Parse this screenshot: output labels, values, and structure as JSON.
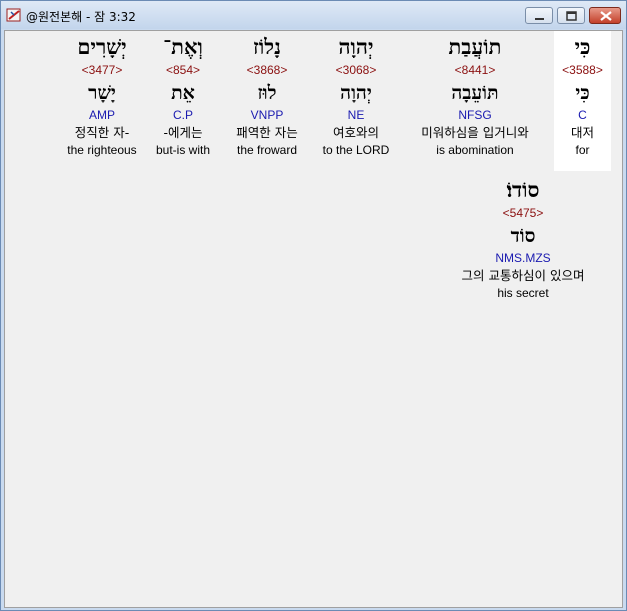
{
  "window": {
    "title": "@원전본해 - 잠 3:32",
    "app_icon": "app-icon",
    "controls": [
      "minimize-icon",
      "maximize-icon",
      "close-icon"
    ]
  },
  "words": [
    {
      "hebrew": "כִּי",
      "strong": "<3588>",
      "lemma": "כִּי",
      "morph": "C",
      "korean": "대저",
      "english": "for"
    },
    {
      "hebrew": "תוֹעֲבַת",
      "strong": "<8441>",
      "lemma": "תּוֹעֵבָה",
      "morph": "NFSG",
      "korean": "미워하심을 입거니와",
      "english": "is abomination"
    },
    {
      "hebrew": "יְהוָה",
      "strong": "<3068>",
      "lemma": "יְהוָה",
      "morph": "NE",
      "korean": "여호와의",
      "english": "to the LORD"
    },
    {
      "hebrew": "נָלוֹז",
      "strong": "<3868>",
      "lemma": "לוּז",
      "morph": "VNPP",
      "korean": "패역한 자는",
      "english": "the froward"
    },
    {
      "hebrew": "וְאֶת־",
      "strong": "<854>",
      "lemma": "אֵת",
      "morph": "C.P",
      "korean": "-에게는",
      "english": "but-is with"
    },
    {
      "hebrew": "יְשָׁרִים",
      "strong": "<3477>",
      "lemma": "יָשָׁר",
      "morph": "AMP",
      "korean": "정직한 자-",
      "english": "the righteous"
    },
    {
      "hebrew": "סוֹדוֹ׃",
      "strong": "<5475>",
      "lemma": "סוֹד",
      "morph": "NMS.MZS",
      "korean": "그의 교통하심이 있으며",
      "english": "his secret"
    }
  ]
}
